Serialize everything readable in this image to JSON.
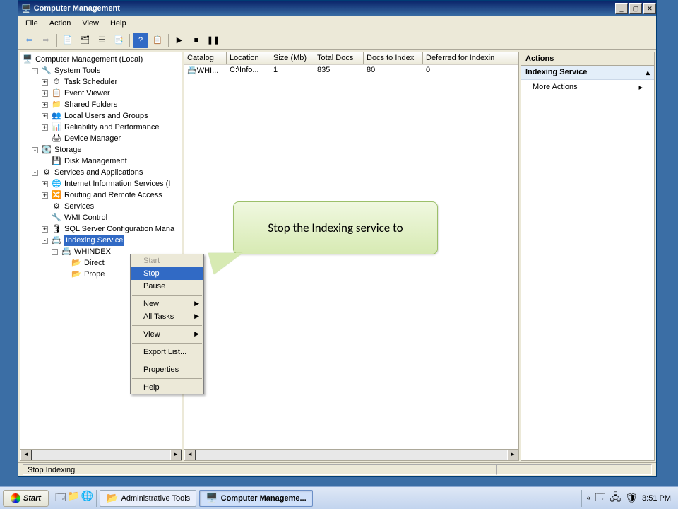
{
  "window": {
    "title": "Computer Management",
    "min": "_",
    "restore": "▢",
    "close": "✕"
  },
  "menus": [
    "File",
    "Action",
    "View",
    "Help"
  ],
  "tree": {
    "root": "Computer Management (Local)",
    "system_tools": "System Tools",
    "task_scheduler": "Task Scheduler",
    "event_viewer": "Event Viewer",
    "shared_folders": "Shared Folders",
    "local_users": "Local Users and Groups",
    "reliability": "Reliability and Performance",
    "device_manager": "Device Manager",
    "storage": "Storage",
    "disk_mgmt": "Disk Management",
    "services_apps": "Services and Applications",
    "iis": "Internet Information Services (I",
    "rras": "Routing and Remote Access",
    "services": "Services",
    "wmi": "WMI Control",
    "sqlcfg": "SQL Server Configuration Mana",
    "indexing": "Indexing Service",
    "whindex": "WHINDEX",
    "directories": "Direct",
    "properties": "Prope"
  },
  "list": {
    "columns": [
      "Catalog",
      "Location",
      "Size (Mb)",
      "Total Docs",
      "Docs to Index",
      "Deferred for Indexin"
    ],
    "rows": [
      {
        "catalog": "WHI...",
        "location": "C:\\Info...",
        "size": "1",
        "total_docs": "835",
        "to_index": "80",
        "deferred": "0"
      }
    ]
  },
  "actions": {
    "header": "Actions",
    "group": "Indexing Service",
    "more": "More Actions"
  },
  "context_menu": {
    "start": "Start",
    "stop": "Stop",
    "pause": "Pause",
    "new": "New",
    "all_tasks": "All Tasks",
    "view": "View",
    "export": "Export List...",
    "properties": "Properties",
    "help": "Help"
  },
  "callout": "Stop the Indexing service to",
  "statusbar": "Stop Indexing",
  "taskbar": {
    "start": "Start",
    "admin_tools": "Administrative Tools",
    "computer_mgmt": "Computer Manageme...",
    "clock": "3:51 PM"
  }
}
